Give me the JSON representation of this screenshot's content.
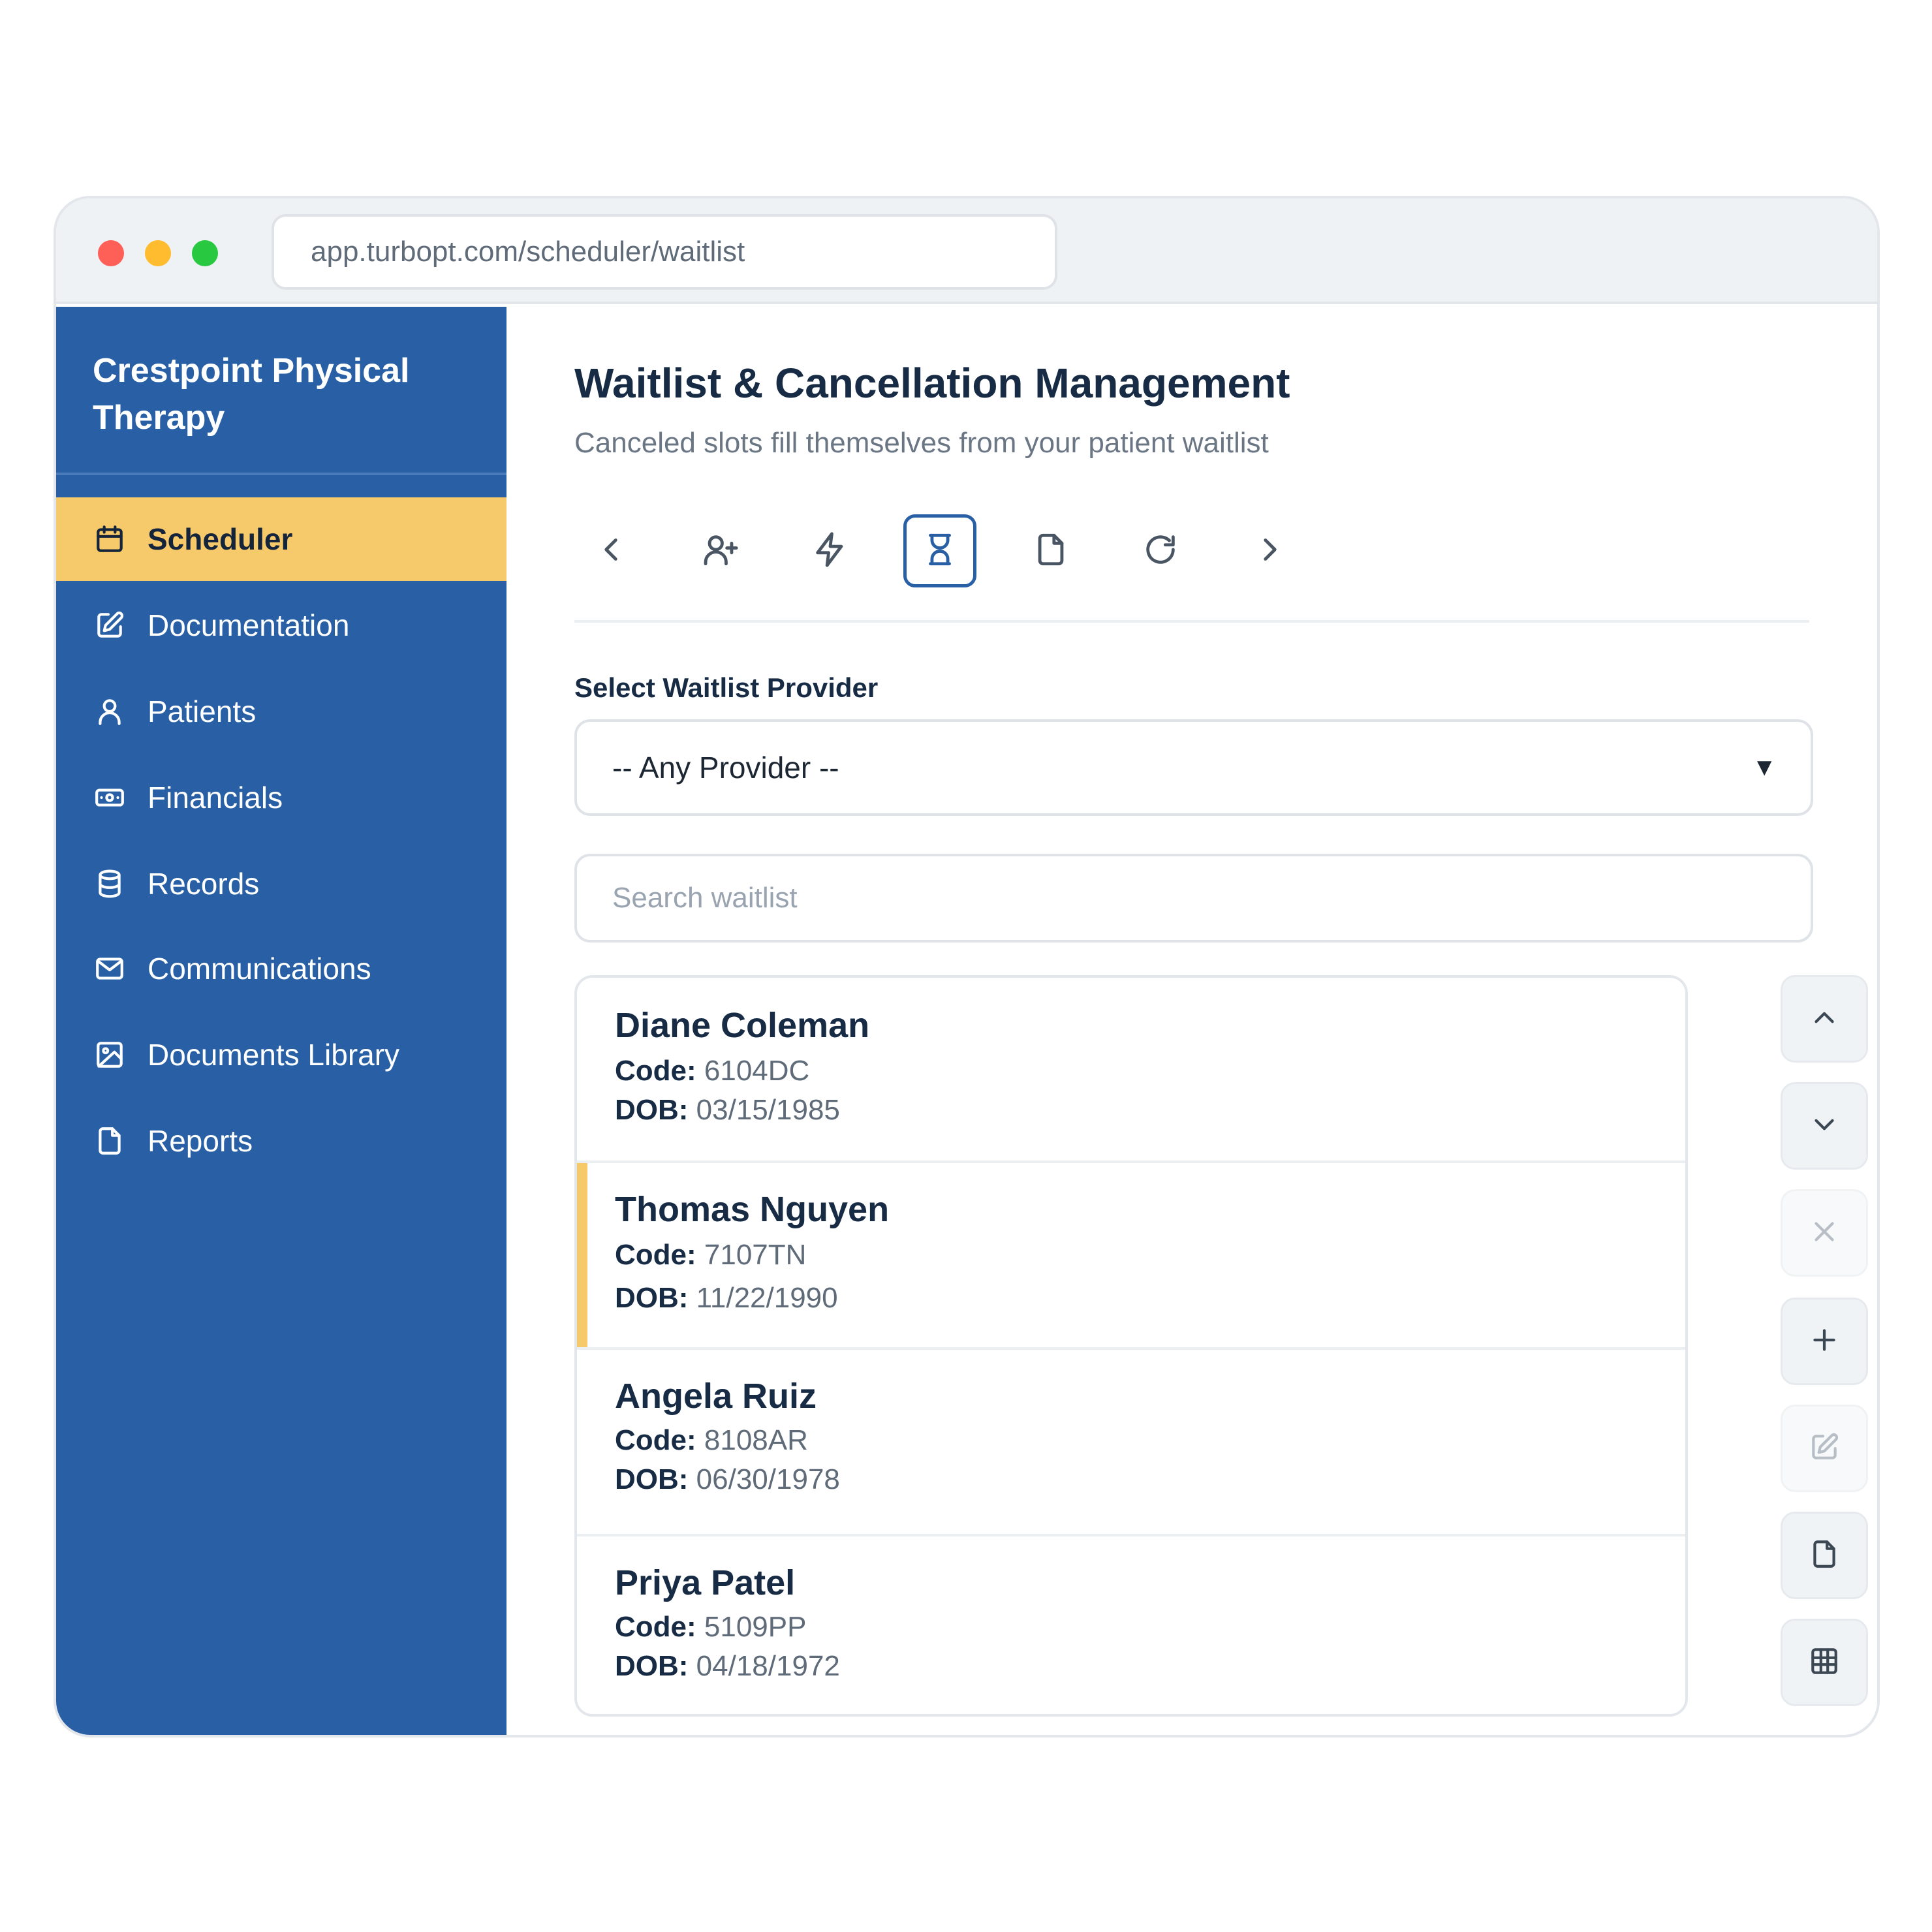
{
  "browser": {
    "url": "app.turbopt.com/scheduler/waitlist"
  },
  "sidebar": {
    "brand": "Crestpoint Physical Therapy",
    "items": [
      {
        "label": "Scheduler",
        "icon": "calendar-icon"
      },
      {
        "label": "Documentation",
        "icon": "edit-icon"
      },
      {
        "label": "Patients",
        "icon": "user-icon"
      },
      {
        "label": "Financials",
        "icon": "cash-icon"
      },
      {
        "label": "Records",
        "icon": "database-icon"
      },
      {
        "label": "Communications",
        "icon": "mail-icon"
      },
      {
        "label": "Documents Library",
        "icon": "image-icon"
      },
      {
        "label": "Reports",
        "icon": "file-icon"
      }
    ],
    "active": "Scheduler"
  },
  "page": {
    "title": "Waitlist & Cancellation Management",
    "subtitle": "Canceled slots fill themselves from your patient waitlist"
  },
  "toolbar": {
    "icons": [
      "chevron-left-icon",
      "user-plus-icon",
      "lightning-icon",
      "hourglass-icon",
      "file-icon",
      "refresh-icon",
      "chevron-right-icon"
    ],
    "active": "hourglass-icon"
  },
  "provider": {
    "label": "Select Waitlist Provider",
    "selected": "-- Any Provider --"
  },
  "search": {
    "placeholder": "Search waitlist",
    "value": ""
  },
  "waitlist": {
    "code_label": "Code:",
    "dob_label": "DOB:",
    "patients": [
      {
        "name": "Diane Coleman",
        "code": "6104DC",
        "dob": "03/15/1985",
        "selected": false
      },
      {
        "name": "Thomas Nguyen",
        "code": "7107TN",
        "dob": "11/22/1990",
        "selected": true
      },
      {
        "name": "Angela Ruiz",
        "code": "8108AR",
        "dob": "06/30/1978",
        "selected": false
      },
      {
        "name": "Priya Patel",
        "code": "5109PP",
        "dob": "04/18/1972",
        "selected": false
      }
    ]
  },
  "actions": [
    {
      "icon": "chevron-up-icon",
      "enabled": true
    },
    {
      "icon": "chevron-down-icon",
      "enabled": true
    },
    {
      "icon": "close-icon",
      "enabled": false
    },
    {
      "icon": "plus-icon",
      "enabled": true
    },
    {
      "icon": "edit-icon",
      "enabled": false
    },
    {
      "icon": "file-icon",
      "enabled": true
    },
    {
      "icon": "table-icon",
      "enabled": true
    }
  ],
  "colors": {
    "sidebar": "#2960a5",
    "accent": "#f6c96a",
    "title": "#172b45"
  }
}
